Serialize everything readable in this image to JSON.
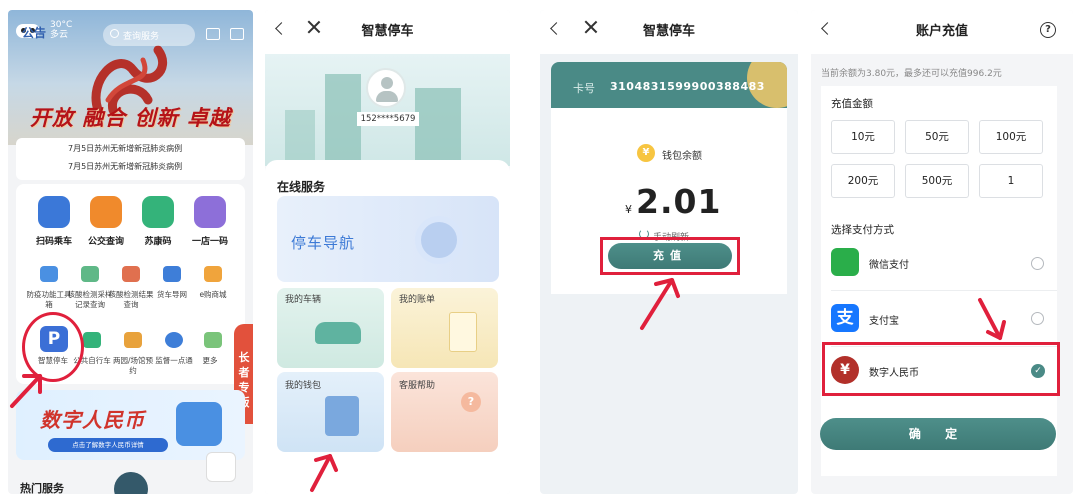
{
  "panel1": {
    "weather_temp": "30°C",
    "weather_note": "多云",
    "search_placeholder": "查询服务",
    "slogan": [
      "开放",
      "融合",
      "创新",
      "卓越"
    ],
    "notice_tag": "公告",
    "notices": [
      "7月5日苏州无新增新冠肺炎病例",
      "7月5日苏州无新增新冠肺炎病例"
    ],
    "main_services": [
      {
        "label": "扫码乘车",
        "color": "#3b78d8",
        "icon": "bus-code-icon"
      },
      {
        "label": "公交查询",
        "color": "#f08a2c",
        "icon": "bus-icon"
      },
      {
        "label": "苏康码",
        "color": "#34b37a",
        "icon": "health-code-icon"
      },
      {
        "label": "一店一码",
        "color": "#8d6fd9",
        "icon": "store-code-icon"
      }
    ],
    "row2": [
      {
        "label": "防疫功能工具箱",
        "color": "#4a90e2"
      },
      {
        "label": "核酸检测采样记录查询",
        "color": "#5fb887"
      },
      {
        "label": "核酸检测结果查询",
        "color": "#e0704f"
      },
      {
        "label": "货车导网",
        "color": "#3e7ed8"
      },
      {
        "label": "e购商城",
        "color": "#f0a43c"
      }
    ],
    "row3": [
      {
        "label": "智慧停车",
        "color": "#3b6fd6"
      },
      {
        "label": "公共自行车",
        "color": "#34b37a"
      },
      {
        "label": "两园/场馆预约",
        "color": "#e8a23c"
      },
      {
        "label": "监督一点通",
        "color": "#3e7ed8"
      },
      {
        "label": "更多",
        "color": "#7ac47a"
      }
    ],
    "elder_label": "长者专版",
    "banner_title": "数字人民币",
    "banner_sub": "点击了解数字人民币详情",
    "hot_services": "热门服务"
  },
  "panel2": {
    "title": "智慧停车",
    "phone": "152****5679",
    "section": "在线服务",
    "nav_tile": "停车导航",
    "tiles": [
      "我的车辆",
      "我的账单",
      "我的钱包",
      "客服帮助"
    ]
  },
  "panel3": {
    "title": "智慧停车",
    "card_no_label": "卡号",
    "card_no": "3104831599900388483",
    "wallet_label": "钱包余额",
    "currency": "¥",
    "balance": "2.01",
    "refresh": "手动刷新",
    "recharge_button": "充值"
  },
  "panel4": {
    "title": "账户充值",
    "balance_note": "当前余额为3.80元，最多还可以充值996.2元",
    "amount_section": "充值金额",
    "amounts": [
      "10元",
      "50元",
      "100元",
      "200元",
      "500元",
      "1"
    ],
    "pay_section": "选择支付方式",
    "methods": [
      {
        "label": "微信支付",
        "color": "#2aae4a",
        "icon": "wechat-pay-icon",
        "selected": false
      },
      {
        "label": "支付宝",
        "color": "#1677ff",
        "icon": "alipay-icon",
        "selected": false
      },
      {
        "label": "数字人民币",
        "color": "#b2302a",
        "icon": "digital-rmb-icon",
        "selected": true
      }
    ],
    "confirm_button": "确 定"
  },
  "colors": {
    "accent_teal": "#4a8a86",
    "highlight_red": "#e0203c",
    "alipay_blue": "#1677ff",
    "wechat_green": "#2aae4a"
  }
}
